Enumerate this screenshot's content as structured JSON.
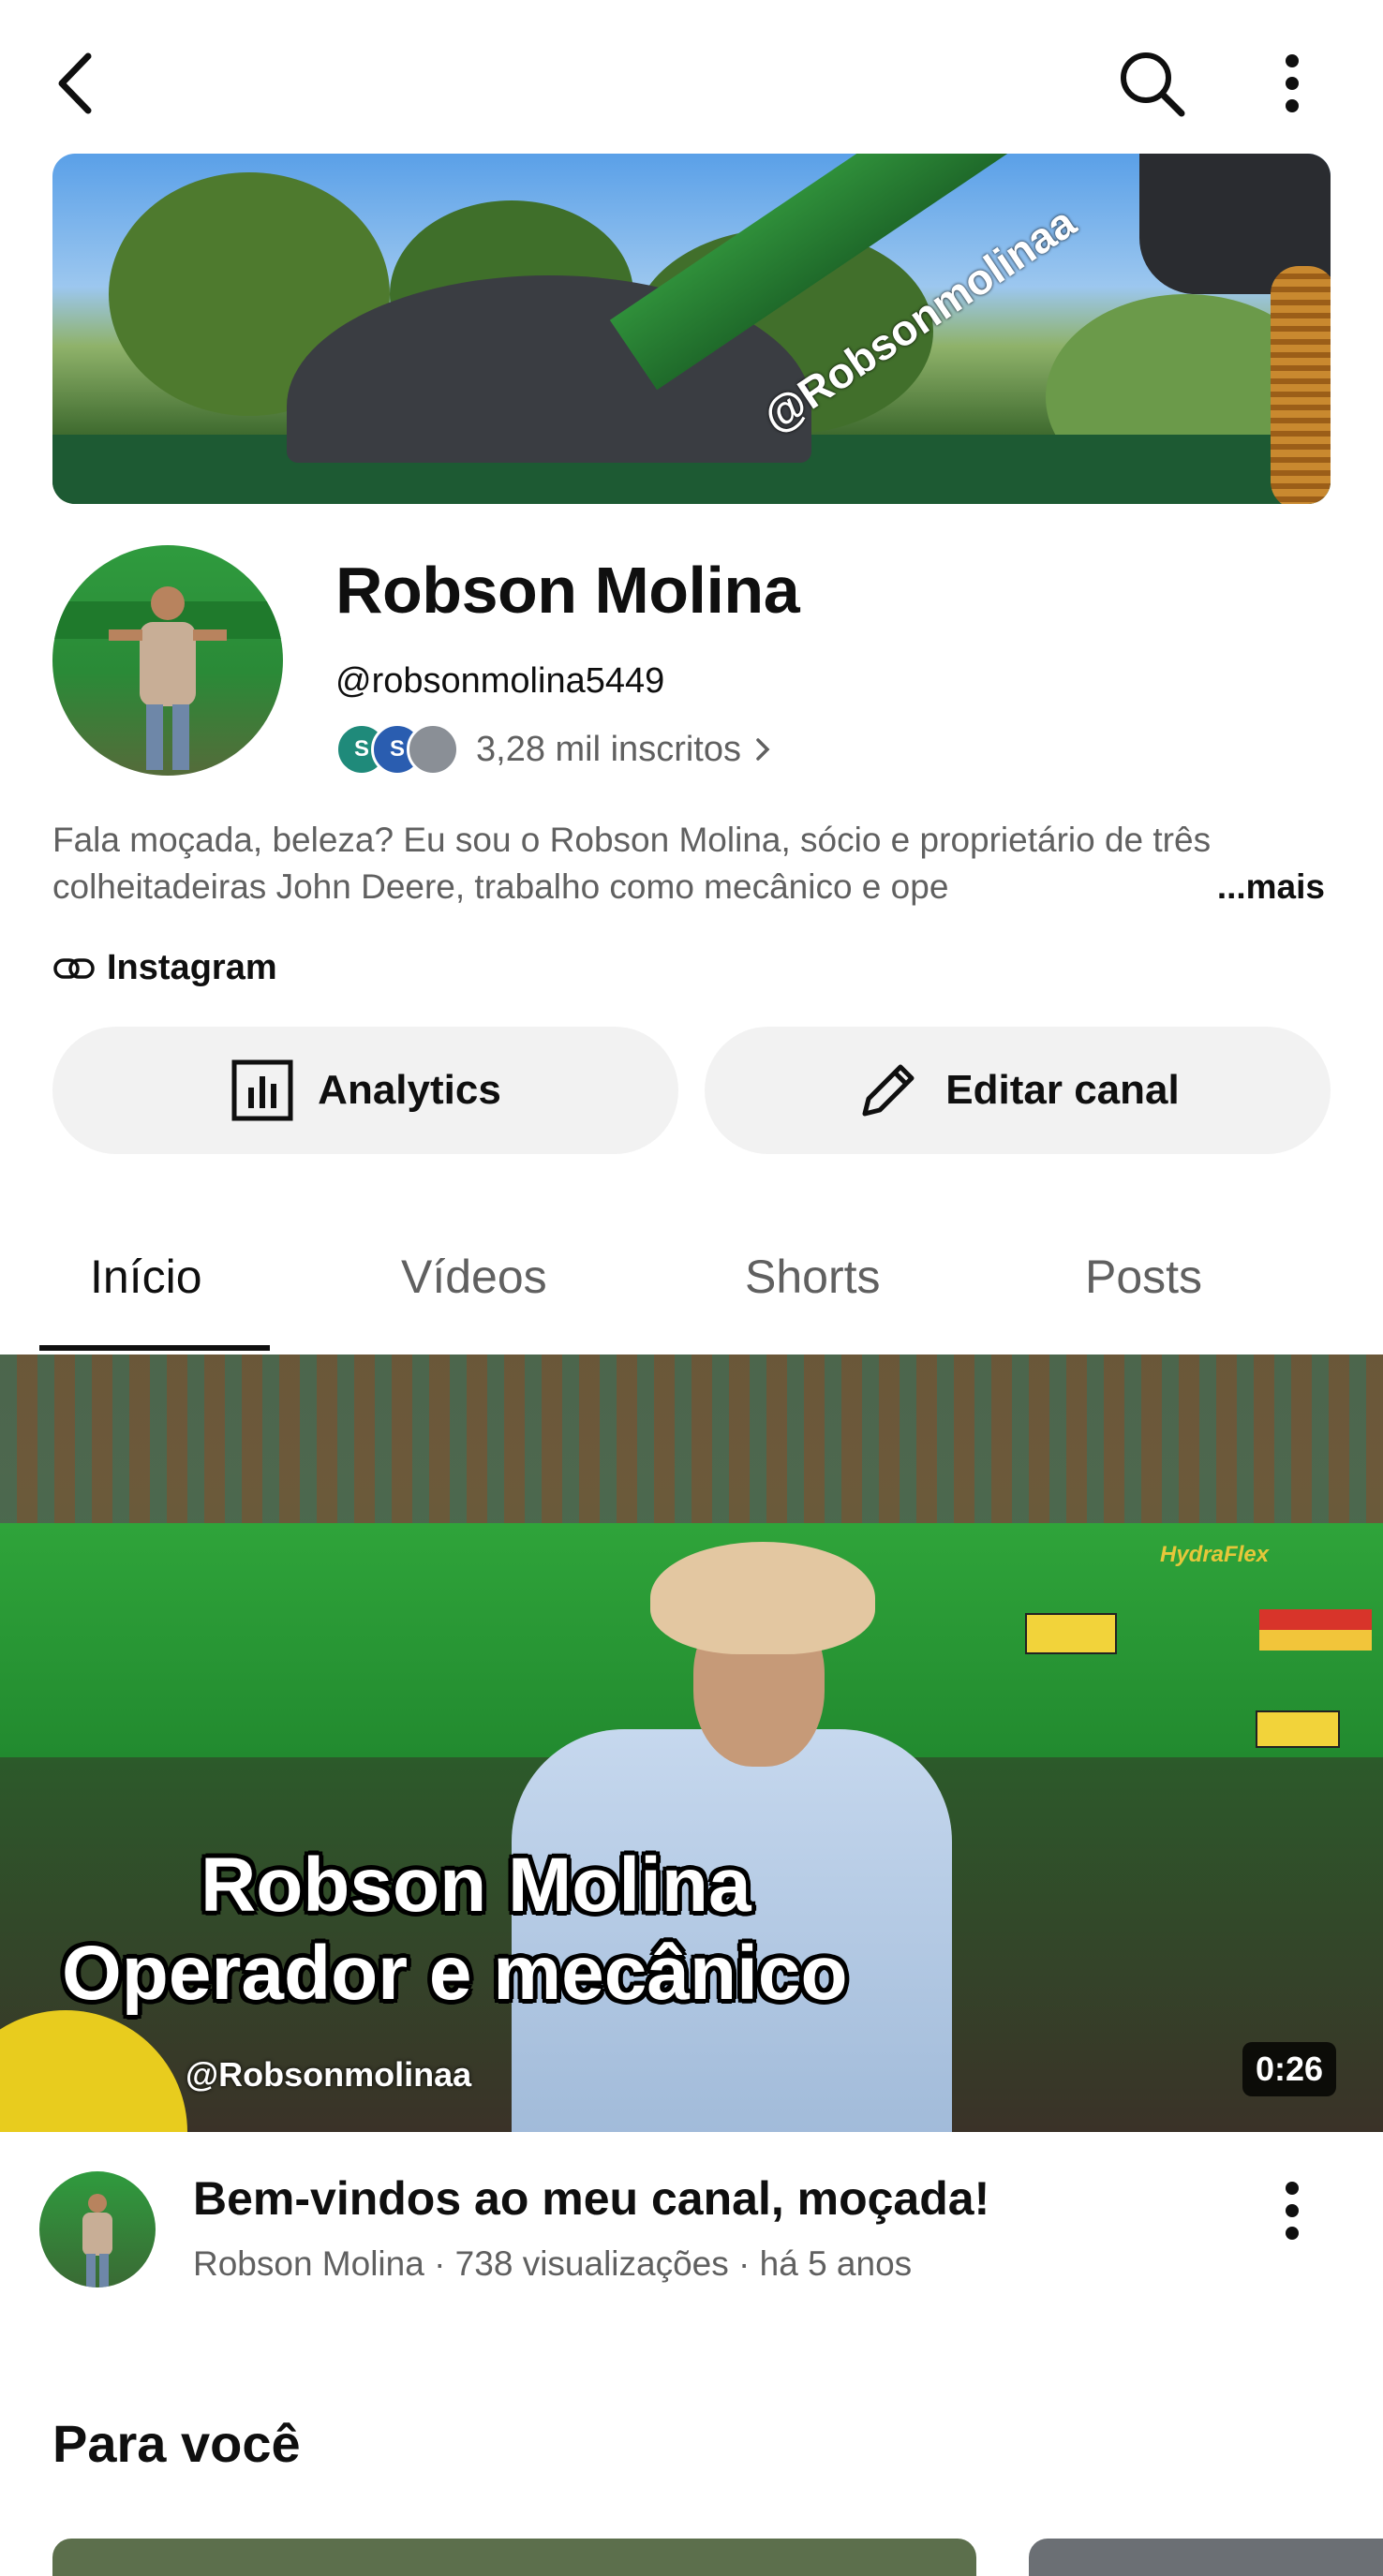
{
  "channel": {
    "name": "Robson Molina",
    "handle": "@robsonmolina5449",
    "subscribers": "3,28 mil inscritos",
    "subscriber_avatar_letters": [
      "S",
      "S"
    ],
    "description": "Fala moçada, beleza? Eu sou o Robson Molina, sócio e proprietário de três colheitadeiras John Deere, trabalho como mecânico e ope",
    "more_label": "...mais",
    "link_label": "Instagram",
    "banner_watermark": "@Robsonmolinaa"
  },
  "buttons": {
    "analytics": "Analytics",
    "edit": "Editar canal"
  },
  "tabs": [
    "Início",
    "Vídeos",
    "Shorts",
    "Posts"
  ],
  "featured_video": {
    "overlay_line1": "Robson Molina",
    "overlay_line2": "Operador e mecânico",
    "watermark": "@Robsonmolinaa",
    "machine_label": "HydraFlex",
    "duration": "0:26",
    "title": "Bem-vindos ao meu canal, moçada!",
    "meta": "Robson Molina · 738 visualizações · há 5 anos"
  },
  "section_title": "Para você",
  "colors": {
    "accent_green": "#2e8a33",
    "mini_avatar_1": "#1f8a7a",
    "mini_avatar_2": "#2a5db0"
  }
}
